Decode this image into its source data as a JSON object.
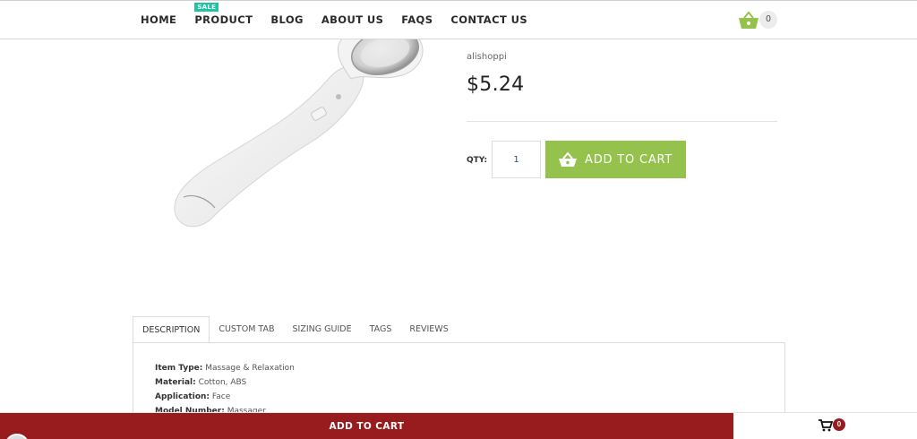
{
  "nav": {
    "items": [
      {
        "label": "HOME"
      },
      {
        "label": "PRODUCT",
        "badge": "SALE"
      },
      {
        "label": "BLOG"
      },
      {
        "label": "ABOUT US"
      },
      {
        "label": "FAQS"
      },
      {
        "label": "CONTACT US"
      }
    ],
    "cart_count": "0",
    "cart_icon": "basket-icon"
  },
  "product": {
    "vendor": "alishoppi",
    "price": "$5.24",
    "qty_label": "QTY:",
    "qty_value": "1",
    "add_to_cart": "ADD TO CART",
    "image_alt": "white handheld facial massager"
  },
  "tabs": {
    "items": [
      "DESCRIPTION",
      "CUSTOM TAB",
      "SIZING GUIDE",
      "TAGS",
      "REVIEWS"
    ],
    "active": "DESCRIPTION"
  },
  "description": {
    "specs": [
      {
        "label": "Item Type:",
        "value": "Massage & Relaxation"
      },
      {
        "label": "Material:",
        "value": "Cotton, ABS"
      },
      {
        "label": "Application:",
        "value": "Face"
      },
      {
        "label": "Model Number:",
        "value": "Massager"
      }
    ]
  },
  "sticky": {
    "add_to_cart": "ADD TO CART",
    "cart_count": "0",
    "cart_icon": "cart-icon"
  },
  "colors": {
    "accent_green": "#95c14d",
    "sticky_red": "#981b1e",
    "sale_badge": "#22c3a3"
  }
}
